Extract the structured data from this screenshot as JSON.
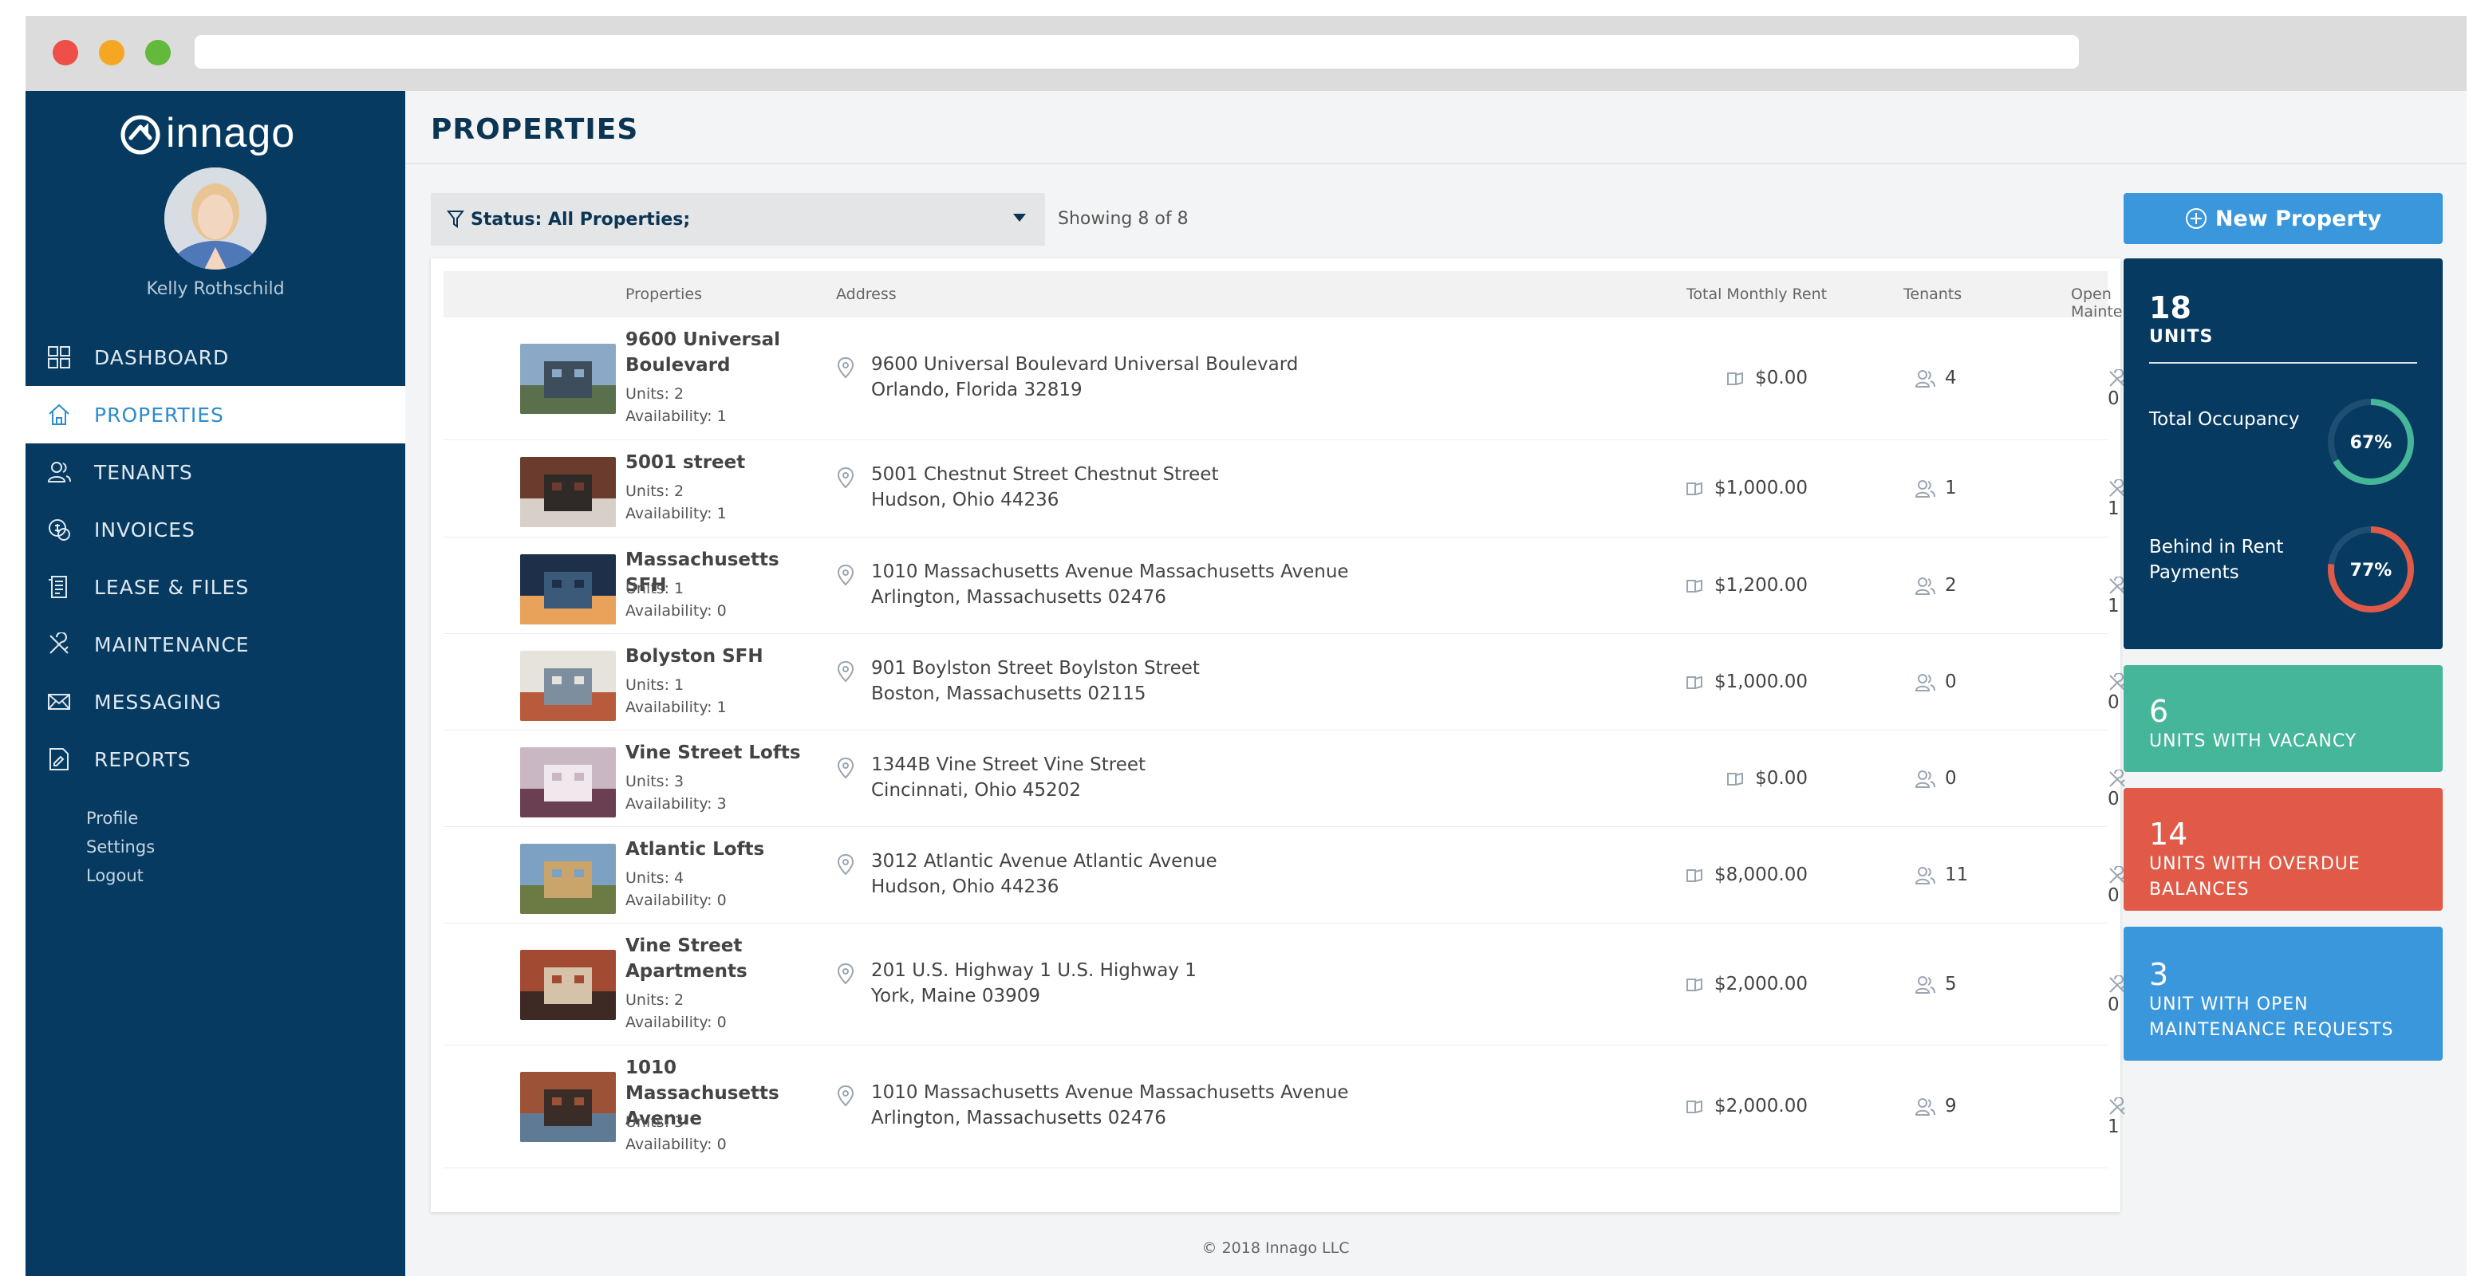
{
  "app": {
    "brand": "innago"
  },
  "user": {
    "name": "Kelly Rothschild"
  },
  "nav": [
    {
      "label": "DASHBOARD",
      "icon": "dashboard-icon"
    },
    {
      "label": "PROPERTIES",
      "icon": "home-icon",
      "active": true
    },
    {
      "label": "TENANTS",
      "icon": "tenants-icon"
    },
    {
      "label": "INVOICES",
      "icon": "invoice-icon"
    },
    {
      "label": "LEASE & FILES",
      "icon": "lease-icon"
    },
    {
      "label": "MAINTENANCE",
      "icon": "tools-icon"
    },
    {
      "label": "MESSAGING",
      "icon": "envelope-icon"
    },
    {
      "label": "REPORTS",
      "icon": "report-icon"
    }
  ],
  "sub_links": [
    "Profile",
    "Settings",
    "Logout"
  ],
  "page": {
    "title": "PROPERTIES"
  },
  "filter": {
    "label": "Status: All Properties;"
  },
  "showing": "Showing 8 of 8",
  "table": {
    "headers": {
      "properties": "Properties",
      "address": "Address",
      "rent": "Total Monthly Rent",
      "tenants": "Tenants",
      "maintenance": "Open Maintenance"
    },
    "rows": [
      {
        "name": "9600 Universal Boulevard",
        "units": "Units: 2",
        "availability": "Availability: 1",
        "address1": "9600 Universal Boulevard Universal Boulevard",
        "address2": "Orlando, Florida 32819",
        "rent": "$0.00",
        "tenants": "4",
        "maintenance": "0"
      },
      {
        "name": "5001 street",
        "units": "Units: 2",
        "availability": "Availability: 1",
        "address1": "5001 Chestnut Street Chestnut Street",
        "address2": "Hudson, Ohio 44236",
        "rent": "$1,000.00",
        "tenants": "1",
        "maintenance": "1"
      },
      {
        "name": "Massachusetts SFH",
        "units": "Units: 1",
        "availability": "Availability: 0",
        "address1": "1010 Massachusetts Avenue Massachusetts Avenue",
        "address2": "Arlington, Massachusetts 02476",
        "rent": "$1,200.00",
        "tenants": "2",
        "maintenance": "1"
      },
      {
        "name": "Bolyston SFH",
        "units": "Units: 1",
        "availability": "Availability: 1",
        "address1": "901 Boylston Street Boylston Street",
        "address2": "Boston, Massachusetts 02115",
        "rent": "$1,000.00",
        "tenants": "0",
        "maintenance": "0"
      },
      {
        "name": "Vine Street Lofts",
        "units": "Units: 3",
        "availability": "Availability: 3",
        "address1": "1344B Vine Street Vine Street",
        "address2": "Cincinnati, Ohio 45202",
        "rent": "$0.00",
        "tenants": "0",
        "maintenance": "0"
      },
      {
        "name": "Atlantic Lofts",
        "units": "Units: 4",
        "availability": "Availability: 0",
        "address1": "3012 Atlantic Avenue Atlantic Avenue",
        "address2": "Hudson, Ohio 44236",
        "rent": "$8,000.00",
        "tenants": "11",
        "maintenance": "0"
      },
      {
        "name": "Vine Street Apartments",
        "units": "Units: 2",
        "availability": "Availability: 0",
        "address1": "201 U.S. Highway 1 U.S. Highway 1",
        "address2": "York, Maine 03909",
        "rent": "$2,000.00",
        "tenants": "5",
        "maintenance": "0"
      },
      {
        "name": "1010 Massachusetts Avenue",
        "units": "Units: 3",
        "availability": "Availability: 0",
        "address1": "1010 Massachusetts Avenue Massachusetts Avenue",
        "address2": "Arlington, Massachusetts 02476",
        "rent": "$2,000.00",
        "tenants": "9",
        "maintenance": "1"
      }
    ]
  },
  "footer": "© 2018 Innago LLC",
  "new_property": "New Property",
  "summary": {
    "units": "18",
    "units_label": "UNITS",
    "occupancy_label": "Total Occupancy",
    "occupancy_value": "67%",
    "occupancy_fraction": 0.67,
    "behind_label": "Behind in Rent Payments",
    "behind_value": "77%",
    "behind_fraction": 0.77
  },
  "tiles": [
    {
      "num": "6",
      "label": "UNITS WITH VACANCY",
      "color": "#46b69a"
    },
    {
      "num": "14",
      "label": "UNITS WITH OVERDUE BALANCES",
      "color": "#e05a47"
    },
    {
      "num": "3",
      "label": "UNIT WITH OPEN MAINTENANCE REQUESTS",
      "color": "#3a97dc"
    }
  ],
  "colors": {
    "sidebar": "#063a60",
    "accent": "#3a97dc",
    "teal": "#46b69a",
    "red": "#e05a47"
  }
}
